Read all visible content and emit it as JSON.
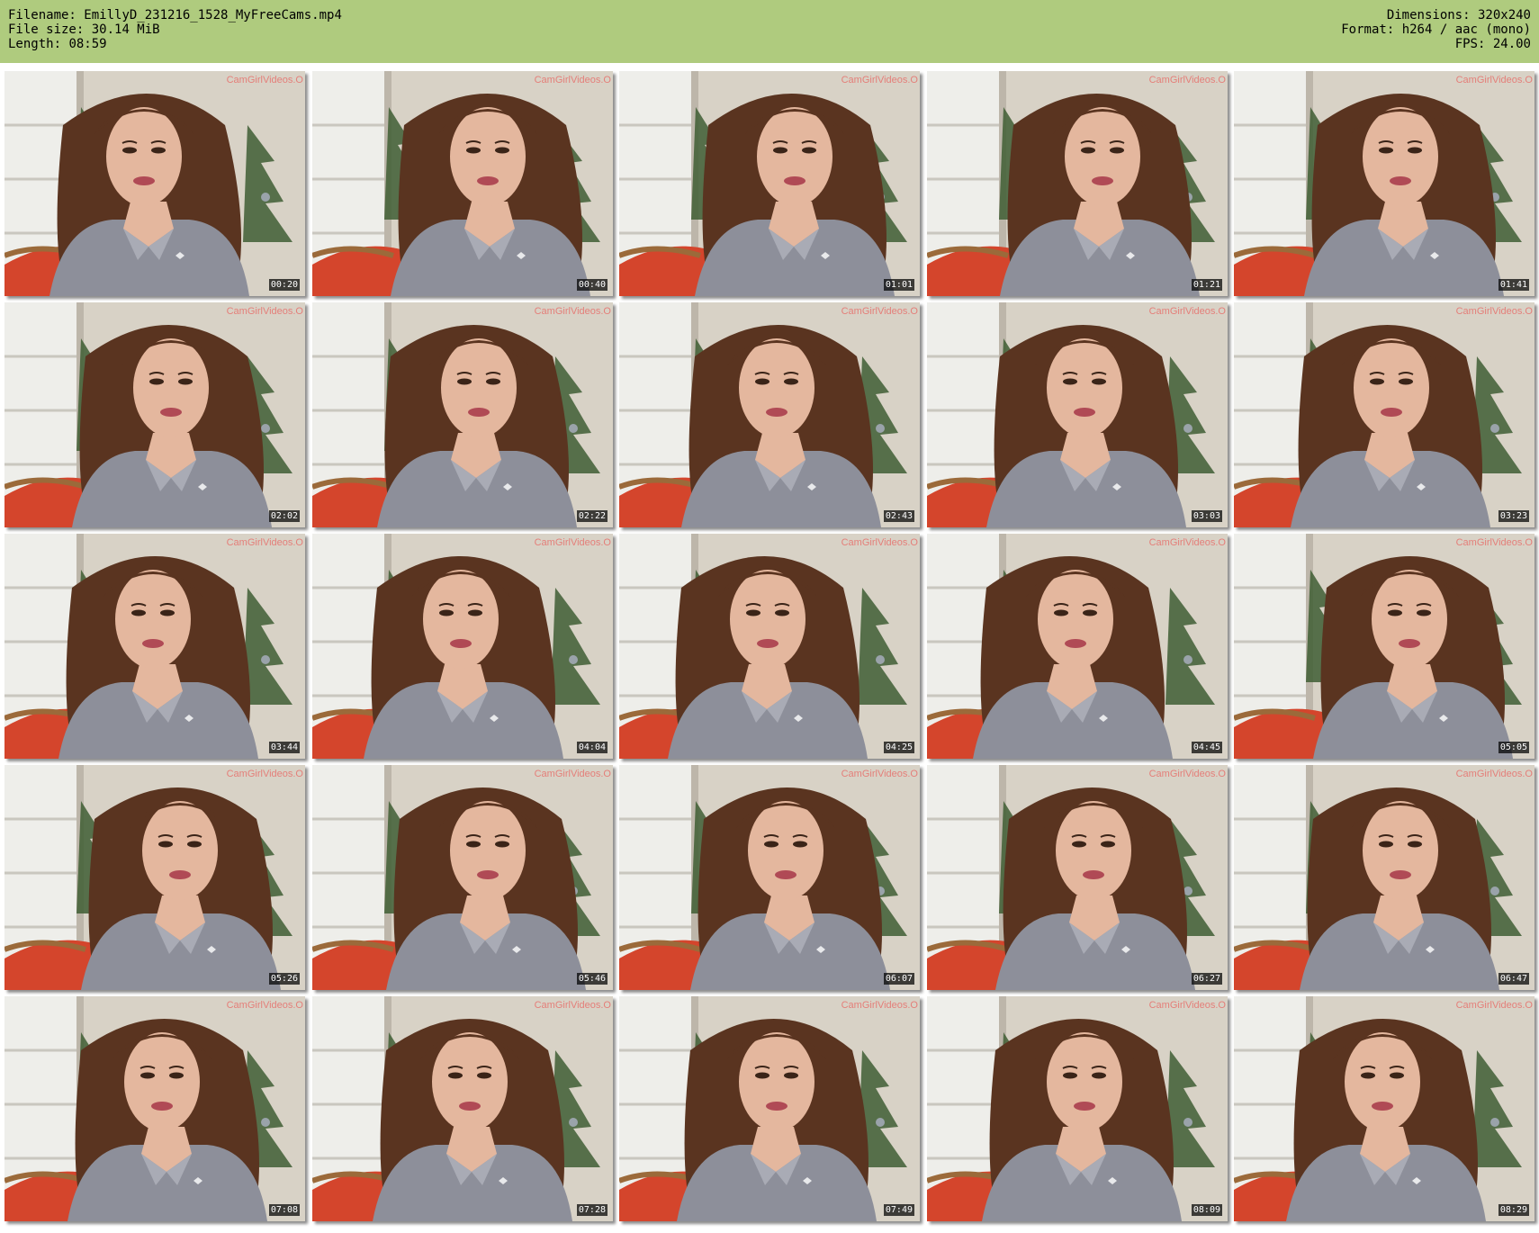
{
  "header": {
    "left": [
      {
        "label": "Filename:",
        "value": "EmillyD_231216_1528_MyFreeCams.mp4"
      },
      {
        "label": "File size:",
        "value": "30.14 MiB"
      },
      {
        "label": "Length:",
        "value": "08:59"
      }
    ],
    "right": [
      {
        "label": "Dimensions:",
        "value": "320x240"
      },
      {
        "label": "Format:",
        "value": "h264 / aac (mono)"
      },
      {
        "label": "FPS:",
        "value": "24.00"
      }
    ]
  },
  "watermark": "CamGirlVideos.O",
  "thumbnails": [
    "00:20",
    "00:40",
    "01:01",
    "01:21",
    "01:41",
    "02:02",
    "02:22",
    "02:43",
    "03:03",
    "03:23",
    "03:44",
    "04:04",
    "04:25",
    "04:45",
    "05:05",
    "05:26",
    "05:46",
    "06:07",
    "06:27",
    "06:47",
    "07:08",
    "07:28",
    "07:49",
    "08:09",
    "08:29"
  ],
  "colors": {
    "header_bg": "#afcb7e",
    "wall": "#d8d2c6",
    "window": "#eeeeea",
    "hair": "#5a3420",
    "shirt": "#8d8f9a",
    "skin": "#e4b79e",
    "cushion": "#d4452c",
    "tree": "#3f5e34"
  }
}
